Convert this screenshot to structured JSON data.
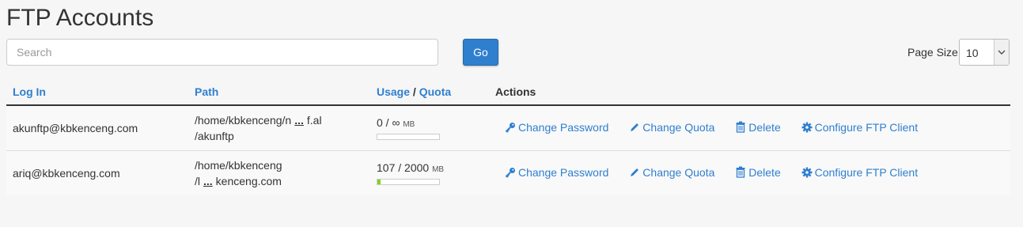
{
  "page": {
    "title": "FTP Accounts"
  },
  "search": {
    "placeholder": "Search",
    "go_label": "Go"
  },
  "page_size": {
    "label": "Page Size",
    "value": "10"
  },
  "table": {
    "headers": {
      "login": "Log In",
      "path": "Path",
      "usage": "Usage",
      "separator": "/",
      "quota": "Quota",
      "actions": "Actions"
    },
    "rows": [
      {
        "login": "akunftp@kbkenceng.com",
        "path_line1_start": "/home/kbkenceng/n",
        "path_ellipsis": "...",
        "path_line1_end": "f.al",
        "path_line2": "/akunftp",
        "usage": "0 / ∞",
        "unit": "MB",
        "usage_fraction": 0
      },
      {
        "login": "ariq@kbkenceng.com",
        "path_line1_start": "/home/kbkenceng",
        "path_ellipsis": "",
        "path_line1_end": "",
        "path_line2_start": "/l",
        "path_line2_ellipsis": "...",
        "path_line2_end": "kenceng.com",
        "usage": "107 / 2000",
        "unit": "MB",
        "usage_fraction": 0.0535
      }
    ],
    "actions": {
      "change_password": "Change Password",
      "change_quota": "Change Quota",
      "delete": "Delete",
      "configure": "Configure FTP Client"
    }
  },
  "colors": {
    "accent": "#2f7fcf",
    "usage_bar": "#7ed321"
  }
}
